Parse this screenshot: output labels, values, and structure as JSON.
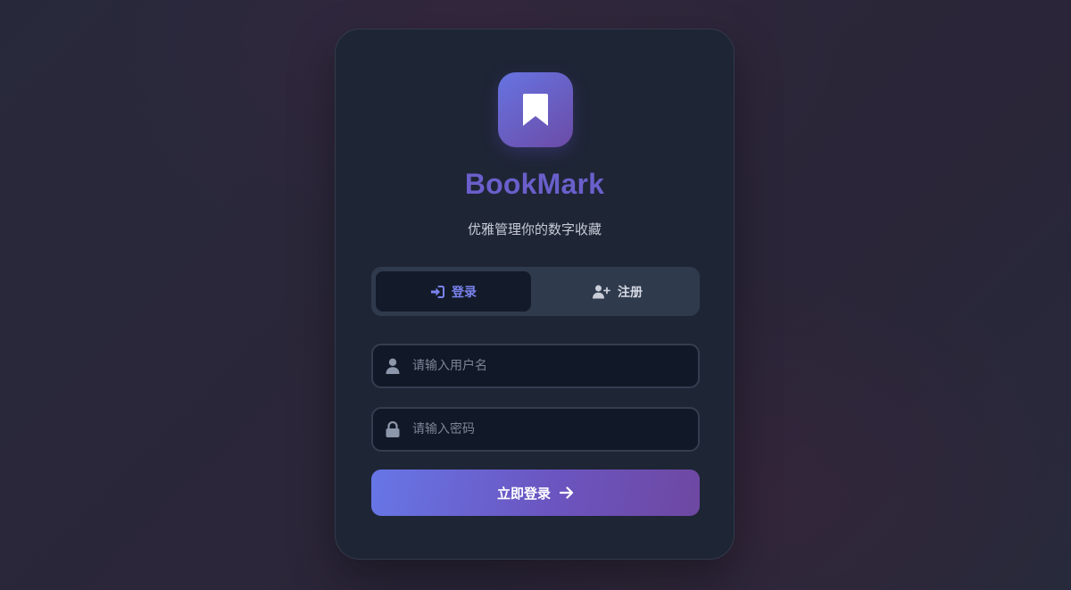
{
  "app": {
    "title": "BookMark",
    "subtitle": "优雅管理你的数字收藏"
  },
  "tabs": [
    {
      "label": "登录",
      "icon": "sign-in-icon",
      "active": true
    },
    {
      "label": "注册",
      "icon": "user-plus-icon",
      "active": false
    }
  ],
  "form": {
    "username": {
      "placeholder": "请输入用户名",
      "value": "",
      "icon": "user-icon"
    },
    "password": {
      "placeholder": "请输入密码",
      "value": "",
      "icon": "lock-icon"
    },
    "submit_label": "立即登录",
    "submit_icon": "arrow-right-icon"
  },
  "colors": {
    "accent": "#6a5fcb",
    "gradient_start": "#6776e6",
    "gradient_end": "#6e48a2",
    "card_bg": "#1e2535",
    "input_bg": "#111827"
  }
}
